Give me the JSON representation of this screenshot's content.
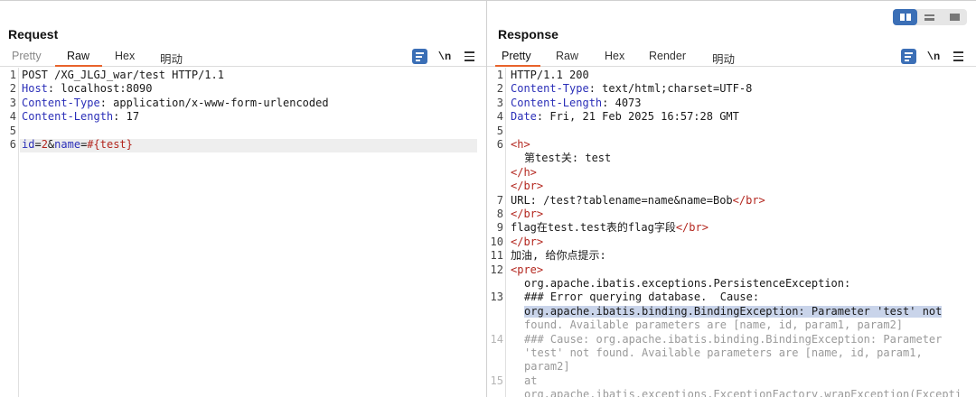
{
  "request": {
    "title": "Request",
    "tabs": [
      {
        "label": "Pretty",
        "state": "inactive"
      },
      {
        "label": "Raw",
        "state": "active"
      },
      {
        "label": "Hex",
        "state": "normal"
      },
      {
        "label": "明动",
        "state": "normal"
      }
    ],
    "toolbar": {
      "wrap_icon": "word-wrap-icon",
      "newline_label": "\\n",
      "menu_icon": "hamburger-menu-icon"
    },
    "lines": [
      {
        "n": "1",
        "parts": [
          [
            "t",
            "POST /XG_JLGJ_war/test HTTP/1.1"
          ]
        ]
      },
      {
        "n": "2",
        "parts": [
          [
            "k",
            "Host"
          ],
          [
            "t",
            ": localhost:8090"
          ]
        ]
      },
      {
        "n": "3",
        "parts": [
          [
            "k",
            "Content-Type"
          ],
          [
            "t",
            ": application/x-www-form-urlencoded"
          ]
        ]
      },
      {
        "n": "4",
        "parts": [
          [
            "k",
            "Content-Length"
          ],
          [
            "t",
            ": 17"
          ]
        ]
      },
      {
        "n": "5",
        "parts": []
      },
      {
        "n": "6",
        "parts": [
          [
            "k",
            "id"
          ],
          [
            "t",
            "="
          ],
          [
            "r",
            "2"
          ],
          [
            "t",
            "&"
          ],
          [
            "k",
            "name"
          ],
          [
            "t",
            "="
          ],
          [
            "r",
            "#{test}"
          ]
        ]
      }
    ]
  },
  "response": {
    "title": "Response",
    "tabs": [
      {
        "label": "Pretty",
        "state": "active"
      },
      {
        "label": "Raw",
        "state": "normal"
      },
      {
        "label": "Hex",
        "state": "normal"
      },
      {
        "label": "Render",
        "state": "normal"
      },
      {
        "label": "明动",
        "state": "normal"
      }
    ],
    "toolbar": {
      "wrap_icon": "word-wrap-icon",
      "newline_label": "\\n",
      "menu_icon": "hamburger-menu-icon"
    },
    "lines": [
      {
        "n": "1",
        "indent": 0,
        "parts": [
          [
            "t",
            "HTTP/1.1 200"
          ]
        ]
      },
      {
        "n": "2",
        "indent": 0,
        "parts": [
          [
            "k",
            "Content-Type"
          ],
          [
            "t",
            ": text/html;charset=UTF-8"
          ]
        ]
      },
      {
        "n": "3",
        "indent": 0,
        "parts": [
          [
            "k",
            "Content-Length"
          ],
          [
            "t",
            ": 4073"
          ]
        ]
      },
      {
        "n": "4",
        "indent": 0,
        "parts": [
          [
            "k",
            "Date"
          ],
          [
            "t",
            ": Fri, 21 Feb 2025 16:57:28 GMT"
          ]
        ]
      },
      {
        "n": "5",
        "indent": 0,
        "parts": []
      },
      {
        "n": "6",
        "indent": 0,
        "parts": [
          [
            "tag",
            "<h>"
          ]
        ]
      },
      {
        "n": "",
        "indent": 1,
        "parts": [
          [
            "t",
            "第test关: test"
          ]
        ]
      },
      {
        "n": "",
        "indent": 0,
        "parts": [
          [
            "tag",
            "</h>"
          ]
        ]
      },
      {
        "n": "",
        "indent": 0,
        "parts": [
          [
            "tag",
            "</br>"
          ]
        ]
      },
      {
        "n": "7",
        "indent": 0,
        "parts": [
          [
            "t",
            "URL: /test?tablename=name&name=Bob"
          ],
          [
            "tag",
            "</br>"
          ]
        ]
      },
      {
        "n": "8",
        "indent": 0,
        "parts": [
          [
            "tag",
            "</br>"
          ]
        ]
      },
      {
        "n": "9",
        "indent": 0,
        "parts": [
          [
            "t",
            "flag在test.test表的flag字段"
          ],
          [
            "tag",
            "</br>"
          ]
        ]
      },
      {
        "n": "10",
        "indent": 0,
        "parts": [
          [
            "tag",
            "</br>"
          ]
        ]
      },
      {
        "n": "11",
        "indent": 0,
        "parts": [
          [
            "t",
            "加油, 给你点提示:"
          ]
        ]
      },
      {
        "n": "12",
        "indent": 0,
        "parts": [
          [
            "tag",
            "<pre>"
          ]
        ]
      },
      {
        "n": "",
        "indent": 1,
        "parts": [
          [
            "t",
            "org.apache.ibatis.exceptions.PersistenceException:"
          ]
        ]
      },
      {
        "n": "13",
        "indent": 1,
        "parts": [
          [
            "t",
            "### Error querying database.  Cause:"
          ]
        ]
      },
      {
        "n": "",
        "indent": 1,
        "sel": true,
        "parts": [
          [
            "t",
            "org.apache.ibatis.binding.BindingException: Parameter 'test' not"
          ]
        ]
      },
      {
        "n": "",
        "indent": 1,
        "faded": true,
        "parts": [
          [
            "t",
            "found. Available parameters are [name, id, param1, param2]"
          ]
        ]
      },
      {
        "n": "14",
        "indent": 1,
        "faded": true,
        "parts": [
          [
            "t",
            "### Cause: org.apache.ibatis.binding.BindingException: Parameter"
          ]
        ]
      },
      {
        "n": "",
        "indent": 1,
        "faded": true,
        "parts": [
          [
            "t",
            "'test' not found. Available parameters are [name, id, param1,"
          ]
        ]
      },
      {
        "n": "",
        "indent": 1,
        "faded": true,
        "parts": [
          [
            "t",
            "param2]"
          ]
        ]
      },
      {
        "n": "15",
        "indent": 1,
        "faded": true,
        "parts": [
          [
            "t",
            "at"
          ]
        ]
      },
      {
        "n": "",
        "indent": 1,
        "faded": true,
        "parts": [
          [
            "t",
            "org.apache.ibatis.exceptions.ExceptionFactory.wrapException(Excepti"
          ]
        ]
      }
    ]
  },
  "view_toggle": {
    "options": [
      "split-view-icon",
      "horizontal-view-icon",
      "single-view-icon"
    ],
    "active": "split-view-icon"
  }
}
